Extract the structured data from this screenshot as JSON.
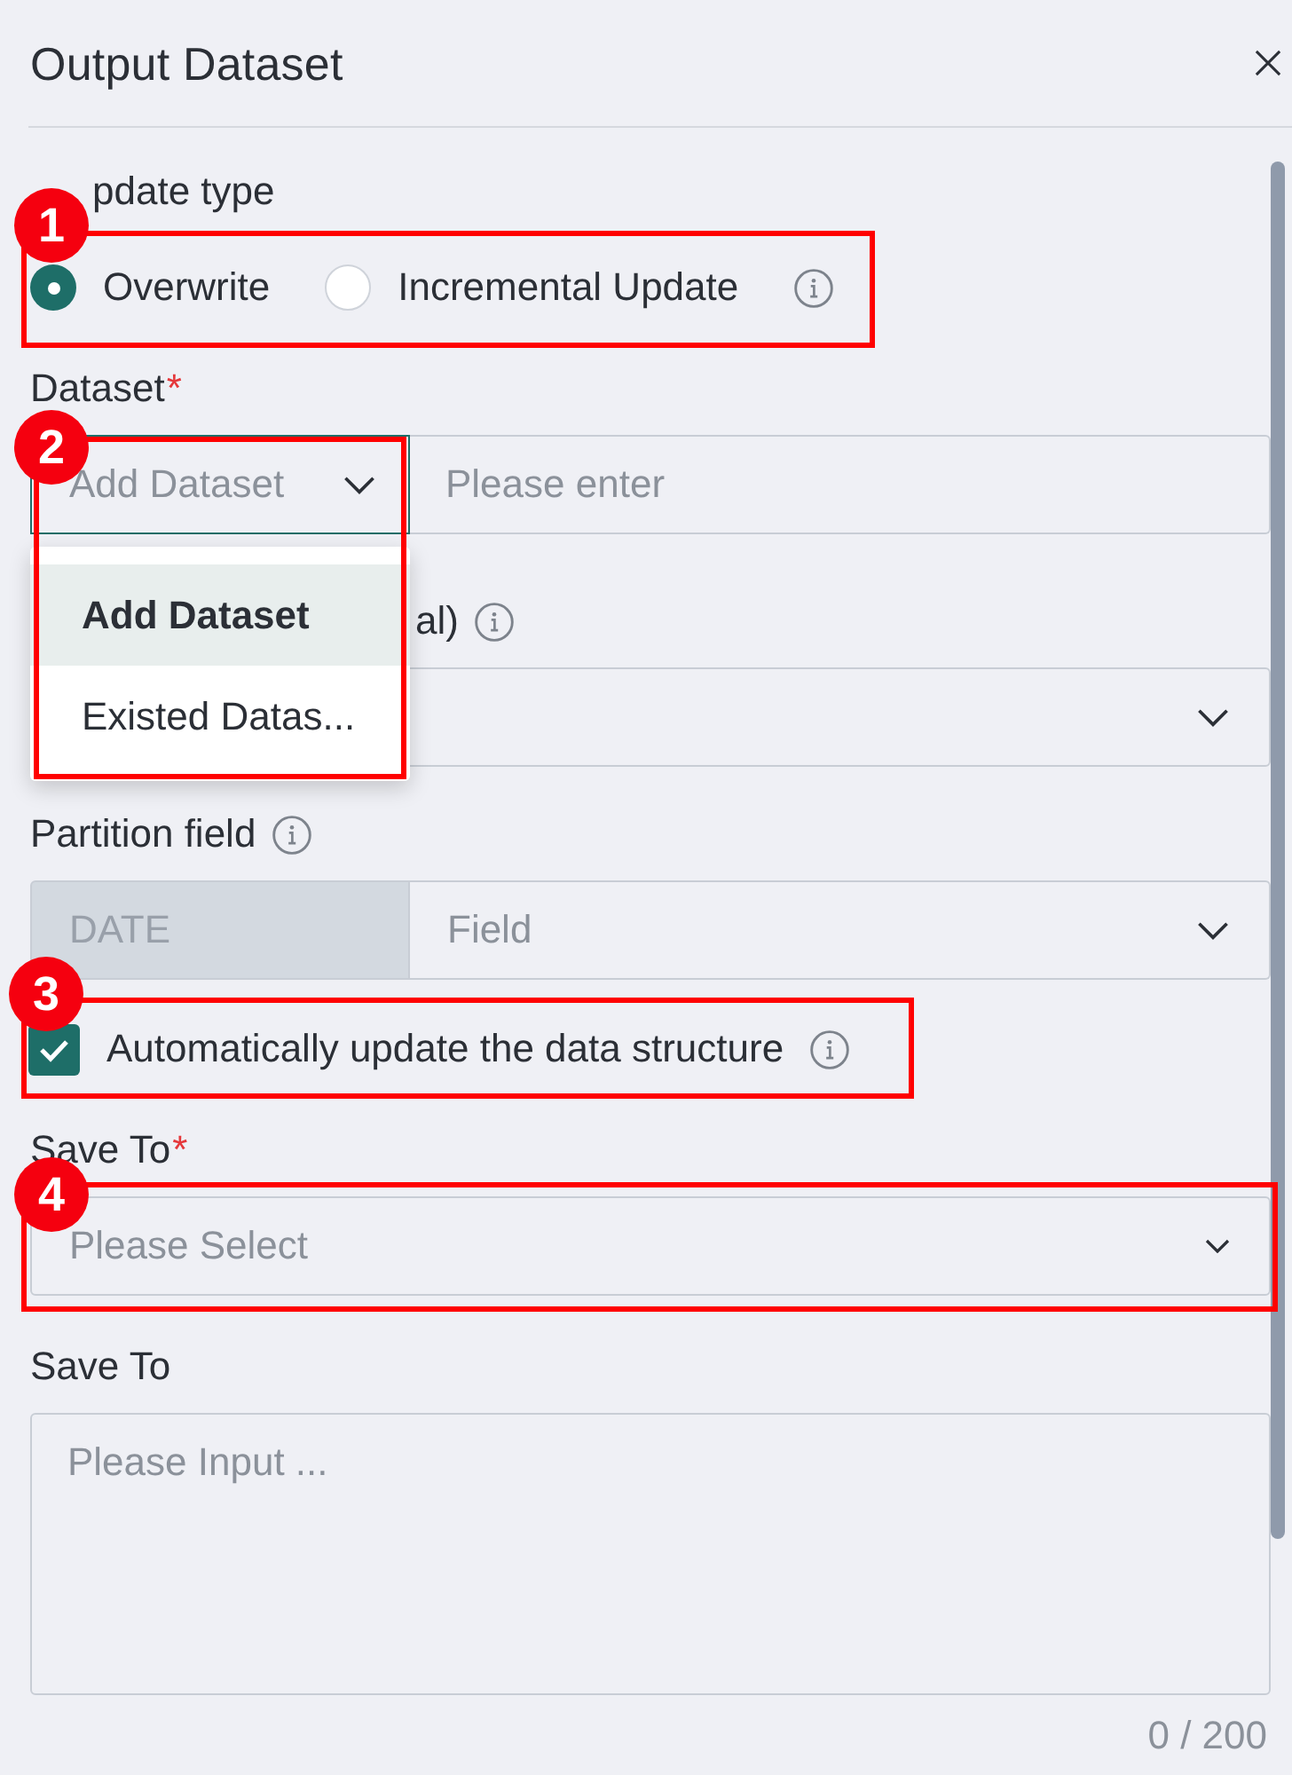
{
  "panel": {
    "title": "Output Dataset"
  },
  "update_type": {
    "label": "pdate type",
    "options": [
      {
        "label": "Overwrite",
        "selected": true
      },
      {
        "label": "Incremental Update",
        "selected": false
      }
    ],
    "callout": "1"
  },
  "dataset": {
    "label": "Dataset",
    "required_mark": "*",
    "type_select": {
      "placeholder": "Add Dataset",
      "focused": true
    },
    "name_input": {
      "placeholder": "Please enter"
    },
    "menu": [
      {
        "label": "Add Dataset",
        "selected": true
      },
      {
        "label": "Existed Datas...",
        "selected": false
      }
    ],
    "callout": "2"
  },
  "covered_field": {
    "label": "al)"
  },
  "partition": {
    "label": "Partition field",
    "type_field": {
      "value": "DATE",
      "disabled": true
    },
    "field_select": {
      "placeholder": "Field"
    }
  },
  "auto_update": {
    "label": "Automatically update the data structure",
    "checked": true,
    "callout": "3"
  },
  "save_to": {
    "label": "Save To",
    "required_mark": "*",
    "select": {
      "placeholder": "Please Select"
    },
    "callout": "4"
  },
  "note": {
    "label": "Save To",
    "textarea": {
      "placeholder": "Please Input ...",
      "counter": "0 / 200"
    }
  }
}
